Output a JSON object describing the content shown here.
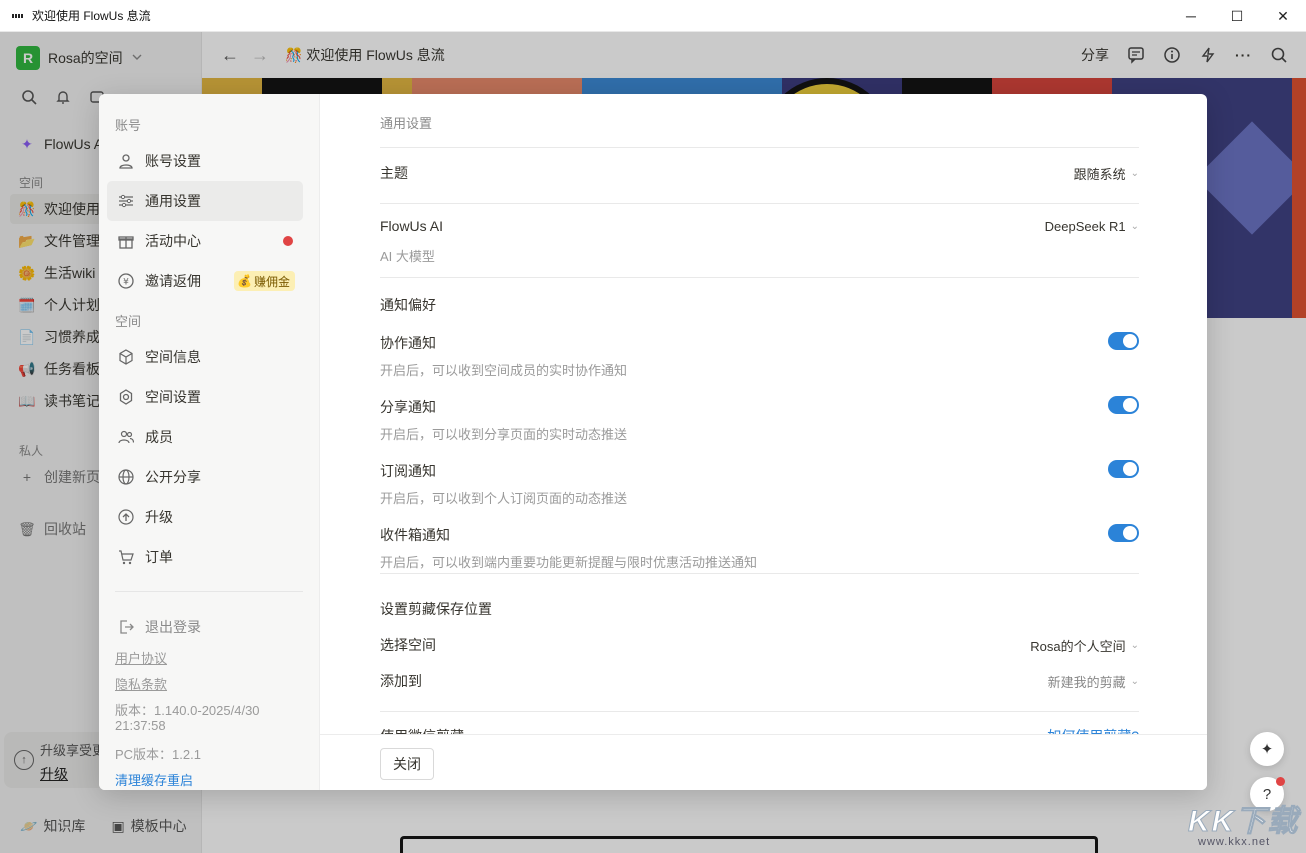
{
  "window": {
    "title": "欢迎使用 FlowUs 息流",
    "controls": {
      "minimize": "─",
      "maximize": "☐",
      "close": "✕"
    }
  },
  "sidebar": {
    "workspace_initial": "R",
    "workspace_name": "Rosa的空间",
    "ai_item": "FlowUs AI",
    "space_label": "空间",
    "items": [
      {
        "emoji": "🎊",
        "label": "欢迎使用 FlowUs 息流"
      },
      {
        "emoji": "📂",
        "label": "文件管理"
      },
      {
        "emoji": "🌼",
        "label": "生活wiki"
      },
      {
        "emoji": "🗓️",
        "label": "个人计划"
      },
      {
        "emoji": "📄",
        "label": "习惯养成"
      },
      {
        "emoji": "📢",
        "label": "任务看板"
      },
      {
        "emoji": "📖",
        "label": "读书笔记"
      }
    ],
    "private_label": "私人",
    "new_page": "创建新页面",
    "trash": "回收站",
    "upgrade_text": "升级享受更多权益",
    "upgrade_link": "升级",
    "knowledge": "知识库",
    "templates": "模板中心"
  },
  "topnav": {
    "page_emoji": "🎊",
    "page_title": "欢迎使用 FlowUs 息流",
    "share": "分享"
  },
  "modal": {
    "nav": {
      "account_group": "账号",
      "account_items": [
        {
          "icon": "user-icon",
          "label": "账号设置"
        },
        {
          "icon": "sliders-icon",
          "label": "通用设置"
        },
        {
          "icon": "gift-icon",
          "label": "活动中心"
        },
        {
          "icon": "yen-icon",
          "label": "邀请返佣"
        }
      ],
      "earn_badge": "赚佣金",
      "space_group": "空间",
      "space_items": [
        {
          "icon": "cube-icon",
          "label": "空间信息"
        },
        {
          "icon": "gear-icon",
          "label": "空间设置"
        },
        {
          "icon": "members-icon",
          "label": "成员"
        },
        {
          "icon": "globe-icon",
          "label": "公开分享"
        },
        {
          "icon": "upgrade-icon",
          "label": "升级"
        },
        {
          "icon": "cart-icon",
          "label": "订单"
        }
      ],
      "logout": "退出登录",
      "user_agreement": "用户协议",
      "privacy": "隐私条款",
      "version_line1": "版本：1.140.0-2025/4/30",
      "version_line2": "21:37:58",
      "pc_version": "PC版本：1.2.1",
      "clear_cache": "清理缓存重启"
    },
    "content": {
      "header": "通用设置",
      "theme_label": "主题",
      "theme_value": "跟随系统",
      "ai_label": "FlowUs AI",
      "ai_sub": "AI 大模型",
      "ai_value": "DeepSeek R1",
      "notify_title": "通知偏好",
      "notifications": [
        {
          "label": "协作通知",
          "desc": "开启后，可以收到空间成员的实时协作通知",
          "on": true
        },
        {
          "label": "分享通知",
          "desc": "开启后，可以收到分享页面的实时动态推送",
          "on": true
        },
        {
          "label": "订阅通知",
          "desc": "开启后，可以收到个人订阅页面的动态推送",
          "on": true
        },
        {
          "label": "收件箱通知",
          "desc": "开启后，可以收到端内重要功能更新提醒与限时优惠活动推送通知",
          "on": true
        }
      ],
      "clip_title": "设置剪藏保存位置",
      "select_space_label": "选择空间",
      "select_space_value": "Rosa的个人空间",
      "add_to_label": "添加到",
      "add_to_value": "新建我的剪藏",
      "partial_left": "使用微信剪藏",
      "partial_right": "如何使用剪藏?"
    },
    "close_button": "关闭"
  },
  "watermark": {
    "big": "KK下载",
    "small": "www.kkx.net"
  },
  "colors": {
    "accent": "#2b83d8",
    "dot": "#e04444",
    "ws_avatar": "#2fb83e"
  }
}
